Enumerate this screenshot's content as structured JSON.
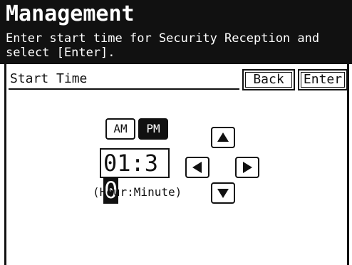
{
  "header": {
    "title": "Management",
    "instruction": "Enter start time for Security Reception and select [Enter]."
  },
  "field": {
    "label": "Start Time"
  },
  "buttons": {
    "back": "Back",
    "enter": "Enter"
  },
  "ampm": {
    "am_label": "AM",
    "pm_label": "PM",
    "selected": "PM"
  },
  "time": {
    "fixed_part": "01:3",
    "cursor_digit": "0",
    "hint": "(Hour:Minute)"
  },
  "icons": {
    "up": "arrow-up-icon",
    "down": "arrow-down-icon",
    "left": "arrow-left-icon",
    "right": "arrow-right-icon"
  },
  "colors": {
    "header_bg": "#111111",
    "header_text": "#ffffff",
    "selected_bg": "#111111"
  }
}
